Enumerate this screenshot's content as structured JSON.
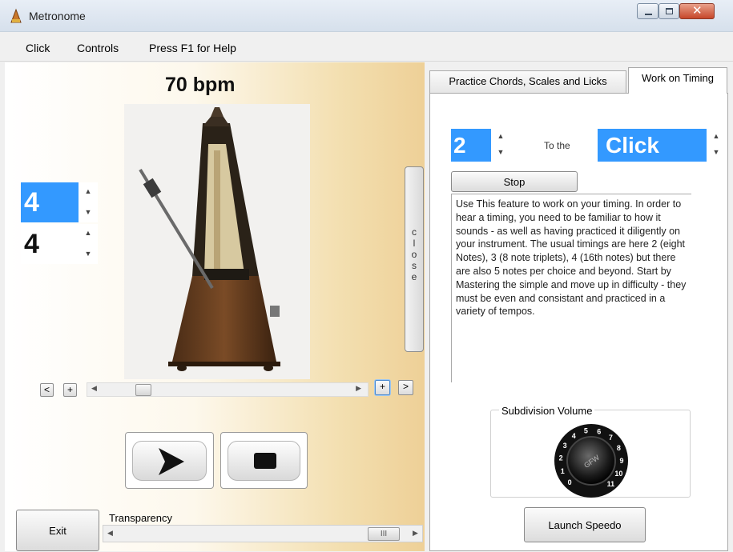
{
  "window": {
    "title": "Metronome",
    "icon": "metronome-app-icon"
  },
  "menu": {
    "items": [
      "Click",
      "Controls",
      "Press F1 for Help"
    ]
  },
  "left": {
    "bpm": "70 bpm",
    "time_signature": {
      "beats": "4",
      "note_value": "4"
    },
    "close_label": [
      "c",
      "l",
      "o",
      "s",
      "e"
    ],
    "tempo_buttons": {
      "dec_small": "<",
      "dec": "+",
      "inc": "+",
      "inc_small": ">"
    },
    "play_icon": "play-icon",
    "stop_icon": "stop-icon",
    "exit_label": "Exit",
    "transparency_label": "Transparency",
    "transparency_thumb": "III"
  },
  "right": {
    "tabs": [
      {
        "label": "Practice Chords, Scales and Licks",
        "active": false
      },
      {
        "label": "Work on Timing",
        "active": true
      }
    ],
    "subdivision_value": "2",
    "to_the": "To the",
    "sound_value": "Click",
    "stop_label": "Stop",
    "info_text": "Use This feature to work on your timing.  In order to hear a timing, you need to be familiar to how it sounds - as well as having practiced it diligently on your instrument.  The usual timings are here 2 (eight Notes), 3 (8 note triplets), 4 (16th notes) but there are also 5 notes per choice and beyond.  Start by Mastering the simple and move up in difficulty - they must be even and consistant and practiced in a variety of tempos.",
    "volume_group_label": "Subdivision Volume",
    "knob_center_label": "GFW",
    "knob_numbers": [
      "0",
      "1",
      "2",
      "3",
      "4",
      "5",
      "6",
      "7",
      "8",
      "9",
      "10",
      "11"
    ],
    "launch_label": "Launch Speedo"
  },
  "colors": {
    "selection_blue": "#3399ff",
    "panel_gold": "#eed097"
  }
}
